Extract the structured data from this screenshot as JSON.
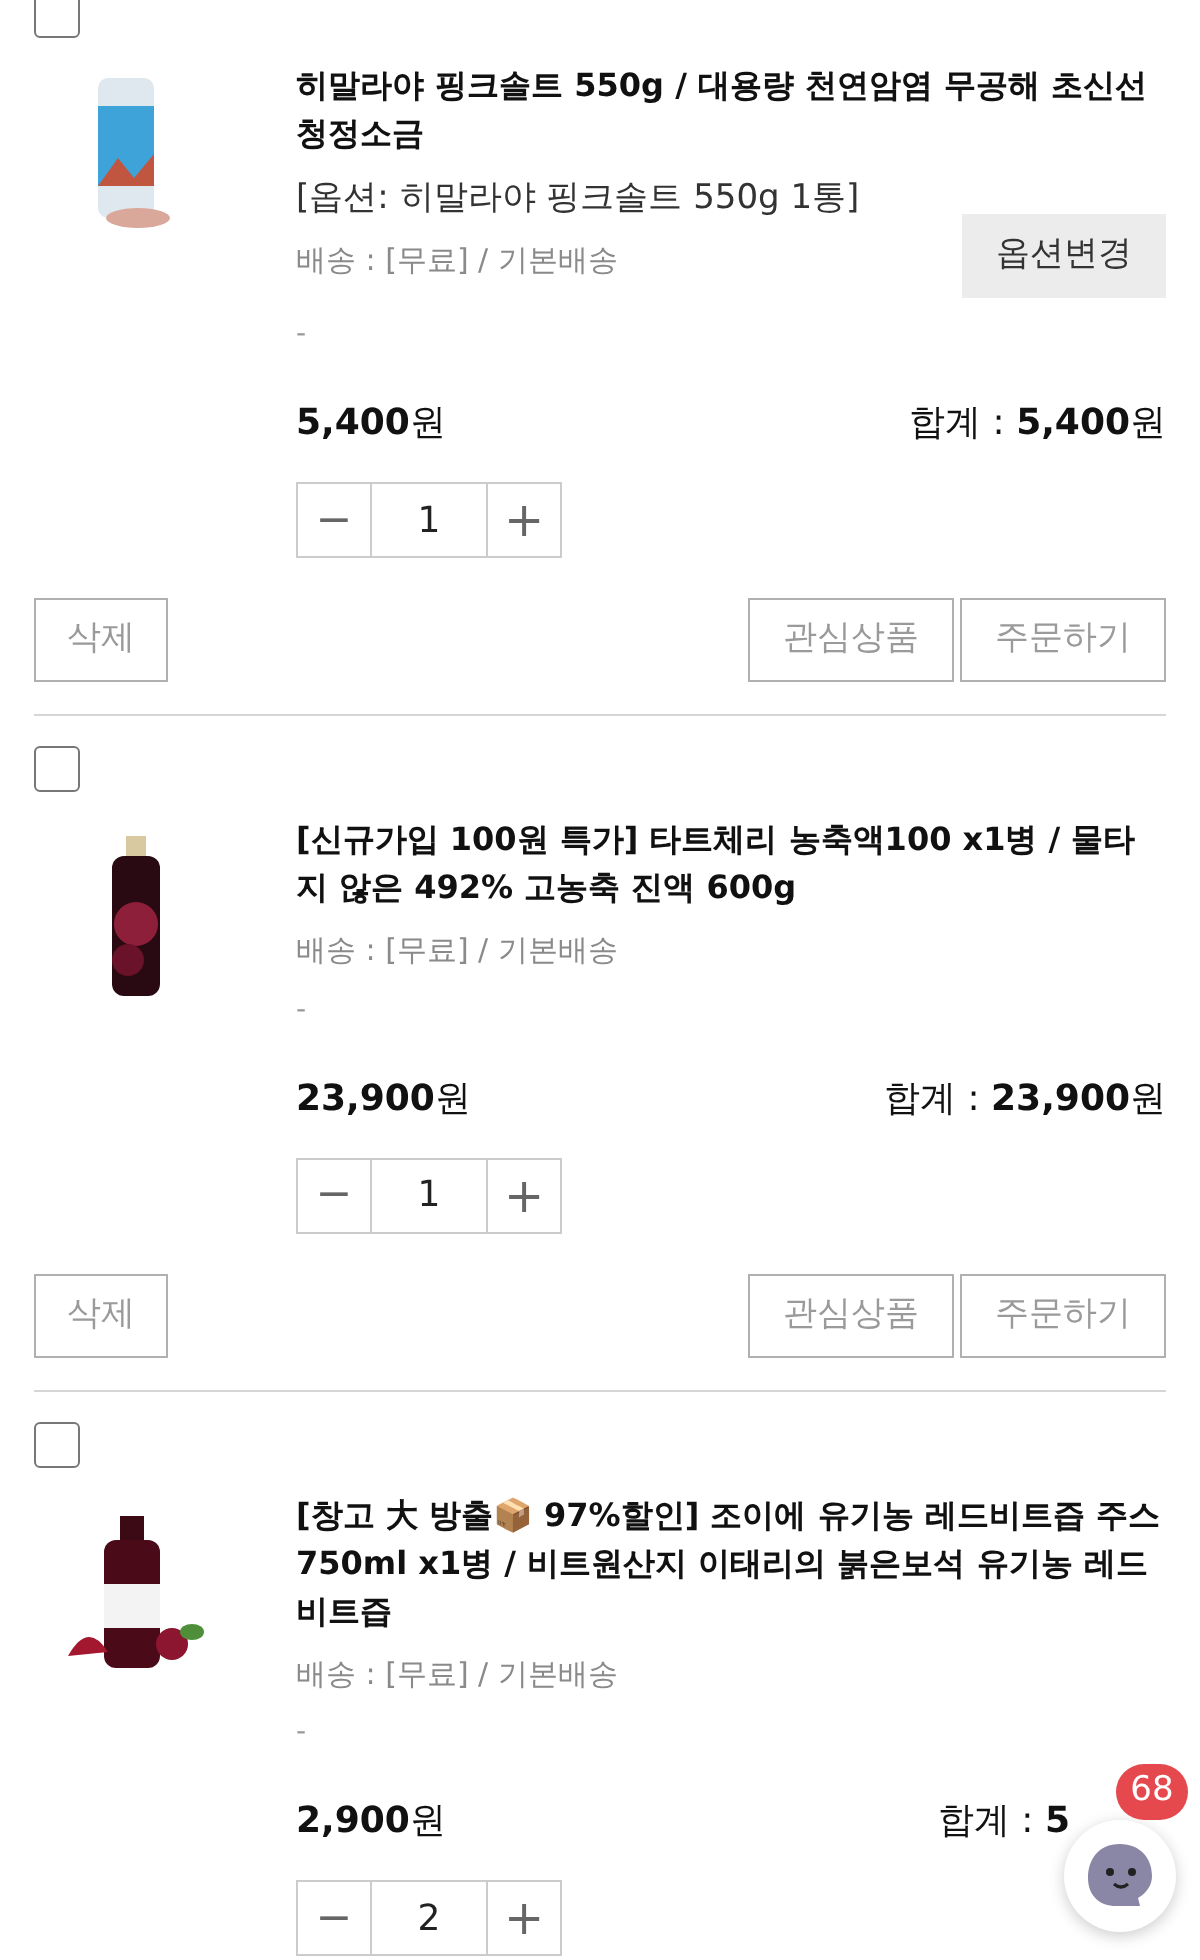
{
  "items": [
    {
      "checked": false,
      "title": "히말라야 핑크솔트 550g / 대용량 천연암염 무공해 초신선 청정소금",
      "option": "[옵션: 히말라야 핑크솔트 550g 1통]",
      "option_button": "옵션변경",
      "shipping": "배송 : [무료] / 기본배송",
      "note": "-",
      "price": "**5,400**원",
      "total": "합계 : **5,400**원",
      "quantity": "1",
      "minus": "−",
      "plus": "+",
      "delete_button": "삭제",
      "wishlist_button": "관심상품",
      "order_button": "주문하기"
    },
    {
      "checked": false,
      "title": "[신규가입 100원 특가] 타트체리 농축액100 x1병 / 물타지 않은 492% 고농축 진액 600g",
      "shipping": "배송 : [무료] / 기본배송",
      "note": "-",
      "price": "**23,900**원",
      "total": "합계 : **23,900**원",
      "quantity": "1",
      "minus": "−",
      "plus": "+",
      "delete_button": "삭제",
      "wishlist_button": "관심상품",
      "order_button": "주문하기"
    },
    {
      "checked": false,
      "title": "[창고 大 방출📦 97%할인] 조이에 유기농 레드비트즙 주스 750ml x1병 / 비트원산지 이태리의 붉은보석 유기농 레드비트즙",
      "shipping": "배송 : [무료] / 기본배송",
      "note": "-",
      "price": "**2,900**원",
      "total": "합계 : **5**",
      "quantity": "2",
      "minus": "−",
      "plus": "+"
    }
  ],
  "chat": {
    "badge": "68"
  }
}
